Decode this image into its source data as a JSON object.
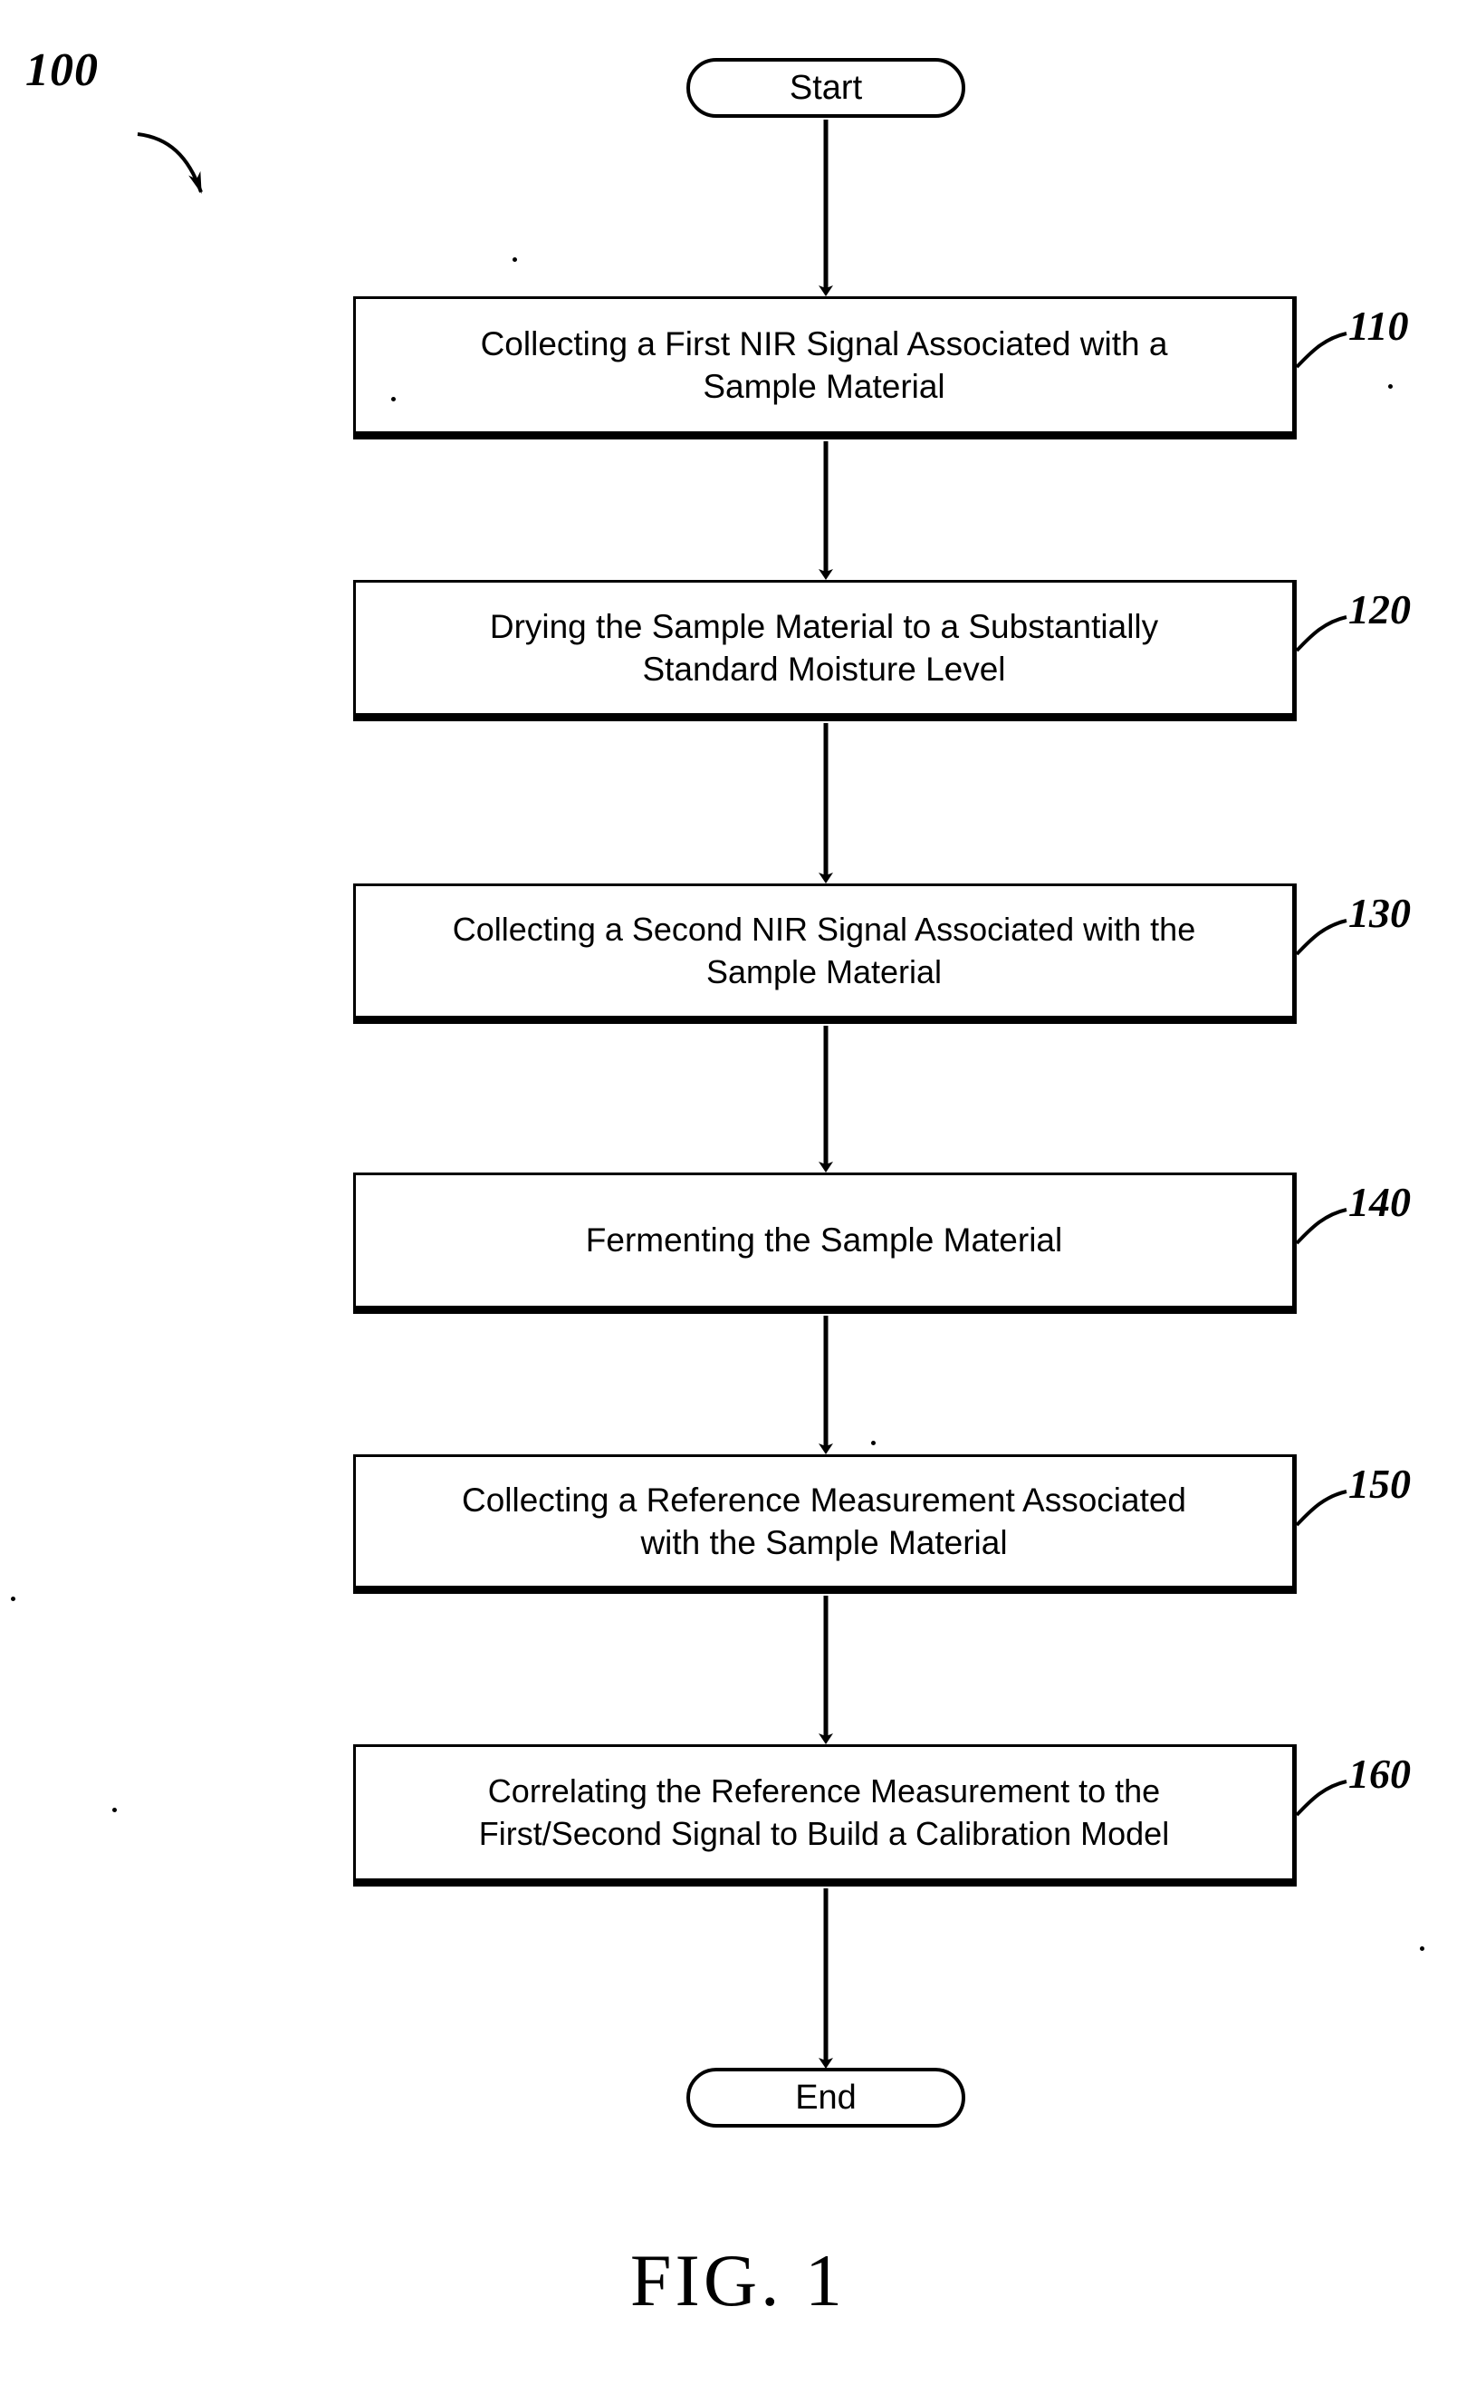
{
  "figure": {
    "caption": "FIG. 1",
    "diagram_numeral": "100",
    "type": "flowchart",
    "orientation": "vertical-top-to-bottom"
  },
  "nodes": {
    "start": {
      "label": "Start",
      "shape": "stadium"
    },
    "end": {
      "label": "End",
      "shape": "stadium"
    },
    "steps": [
      {
        "ref": "110",
        "shape": "rectangle",
        "line1": "Collecting a First NIR Signal Associated with a",
        "line2": "Sample Material",
        "text": "Collecting a First NIR Signal Associated with a Sample Material"
      },
      {
        "ref": "120",
        "shape": "rectangle",
        "line1": "Drying the Sample Material to a Substantially",
        "line2": "Standard Moisture Level",
        "text": "Drying the Sample Material to a Substantially Standard Moisture Level"
      },
      {
        "ref": "130",
        "shape": "rectangle",
        "line1": "Collecting a Second NIR Signal Associated with the",
        "line2": "Sample Material",
        "text": "Collecting a Second NIR Signal Associated with the Sample Material"
      },
      {
        "ref": "140",
        "shape": "rectangle",
        "line1": "Fermenting the Sample Material",
        "line2": "",
        "text": "Fermenting the Sample Material"
      },
      {
        "ref": "150",
        "shape": "rectangle",
        "line1": "Collecting a Reference Measurement Associated",
        "line2": "with the Sample Material",
        "text": "Collecting a Reference Measurement Associated with the Sample Material"
      },
      {
        "ref": "160",
        "shape": "rectangle",
        "line1": "Correlating the Reference Measurement to the",
        "line2": "First/Second Signal to Build a Calibration Model",
        "text": "Correlating the Reference Measurement to the First/Second Signal to Build a Calibration Model"
      }
    ]
  },
  "colors": {
    "stroke": "#000000",
    "fill": "#ffffff",
    "text": "#000000"
  }
}
